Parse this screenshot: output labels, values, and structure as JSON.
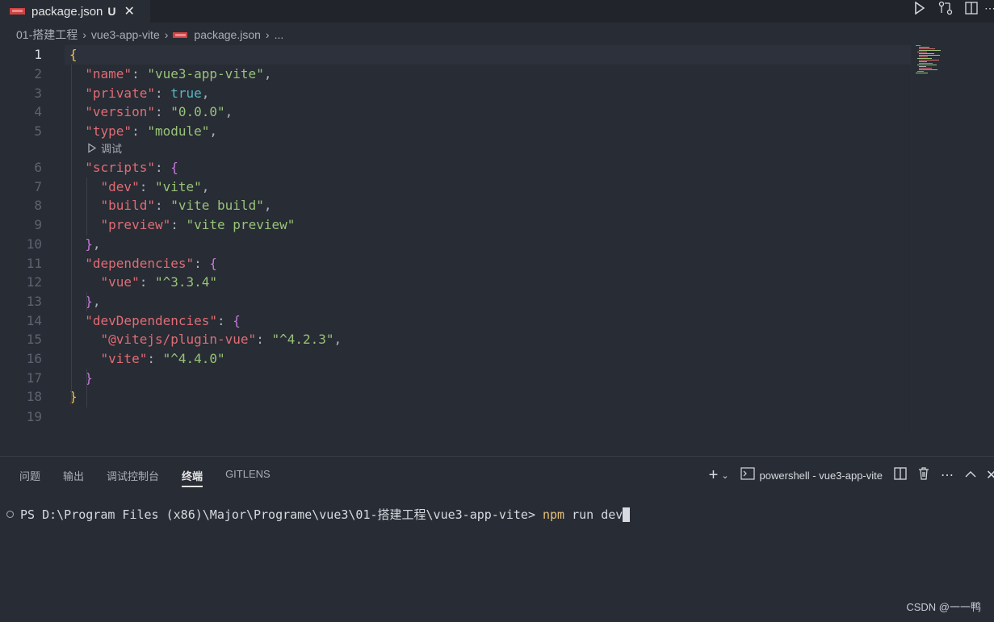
{
  "tab": {
    "label": "package.json",
    "status": "U",
    "close": "✕"
  },
  "breadcrumb": [
    "01-搭建工程",
    "vue3-app-vite",
    "package.json",
    "..."
  ],
  "editor": {
    "codelens": "调试",
    "lines": [
      {
        "n": "1",
        "t": [
          [
            "br1",
            "{"
          ]
        ]
      },
      {
        "n": "2",
        "t": [
          [
            "p",
            "  "
          ],
          [
            "k",
            "\"name\""
          ],
          [
            "p",
            ": "
          ],
          [
            "s",
            "\"vue3-app-vite\""
          ],
          [
            "p",
            ","
          ]
        ]
      },
      {
        "n": "3",
        "t": [
          [
            "p",
            "  "
          ],
          [
            "k",
            "\"private\""
          ],
          [
            "p",
            ": "
          ],
          [
            "b",
            "true"
          ],
          [
            "p",
            ","
          ]
        ]
      },
      {
        "n": "4",
        "t": [
          [
            "p",
            "  "
          ],
          [
            "k",
            "\"version\""
          ],
          [
            "p",
            ": "
          ],
          [
            "s",
            "\"0.0.0\""
          ],
          [
            "p",
            ","
          ]
        ]
      },
      {
        "n": "5",
        "t": [
          [
            "p",
            "  "
          ],
          [
            "k",
            "\"type\""
          ],
          [
            "p",
            ": "
          ],
          [
            "s",
            "\"module\""
          ],
          [
            "p",
            ","
          ]
        ]
      },
      {
        "n": "6",
        "t": [
          [
            "p",
            "  "
          ],
          [
            "k",
            "\"scripts\""
          ],
          [
            "p",
            ": "
          ],
          [
            "br2",
            "{"
          ]
        ]
      },
      {
        "n": "7",
        "t": [
          [
            "p",
            "    "
          ],
          [
            "k",
            "\"dev\""
          ],
          [
            "p",
            ": "
          ],
          [
            "s",
            "\"vite\""
          ],
          [
            "p",
            ","
          ]
        ]
      },
      {
        "n": "8",
        "t": [
          [
            "p",
            "    "
          ],
          [
            "k",
            "\"build\""
          ],
          [
            "p",
            ": "
          ],
          [
            "s",
            "\"vite build\""
          ],
          [
            "p",
            ","
          ]
        ]
      },
      {
        "n": "9",
        "t": [
          [
            "p",
            "    "
          ],
          [
            "k",
            "\"preview\""
          ],
          [
            "p",
            ": "
          ],
          [
            "s",
            "\"vite preview\""
          ]
        ]
      },
      {
        "n": "10",
        "t": [
          [
            "p",
            "  "
          ],
          [
            "br2",
            "}"
          ],
          [
            "p",
            ","
          ]
        ]
      },
      {
        "n": "11",
        "t": [
          [
            "p",
            "  "
          ],
          [
            "k",
            "\"dependencies\""
          ],
          [
            "p",
            ": "
          ],
          [
            "br2",
            "{"
          ]
        ]
      },
      {
        "n": "12",
        "t": [
          [
            "p",
            "    "
          ],
          [
            "k",
            "\"vue\""
          ],
          [
            "p",
            ": "
          ],
          [
            "s",
            "\"^3.3.4\""
          ]
        ]
      },
      {
        "n": "13",
        "t": [
          [
            "p",
            "  "
          ],
          [
            "br2",
            "}"
          ],
          [
            "p",
            ","
          ]
        ]
      },
      {
        "n": "14",
        "t": [
          [
            "p",
            "  "
          ],
          [
            "k",
            "\"devDependencies\""
          ],
          [
            "p",
            ": "
          ],
          [
            "br2",
            "{"
          ]
        ]
      },
      {
        "n": "15",
        "t": [
          [
            "p",
            "    "
          ],
          [
            "k",
            "\"@vitejs/plugin-vue\""
          ],
          [
            "p",
            ": "
          ],
          [
            "s",
            "\"^4.2.3\""
          ],
          [
            "p",
            ","
          ]
        ]
      },
      {
        "n": "16",
        "t": [
          [
            "p",
            "    "
          ],
          [
            "k",
            "\"vite\""
          ],
          [
            "p",
            ": "
          ],
          [
            "s",
            "\"^4.4.0\""
          ]
        ]
      },
      {
        "n": "17",
        "t": [
          [
            "p",
            "  "
          ],
          [
            "br2",
            "}"
          ]
        ]
      },
      {
        "n": "18",
        "t": [
          [
            "br1",
            "}"
          ]
        ]
      },
      {
        "n": "19",
        "t": []
      }
    ]
  },
  "panel": {
    "tabs": [
      "问题",
      "输出",
      "调试控制台",
      "终端",
      "GITLENS"
    ],
    "active_tab": "终端",
    "shell": "powershell - vue3-app-vite",
    "prompt": "PS D:\\Program Files (x86)\\Major\\Programe\\vue3\\01-搭建工程\\vue3-app-vite> ",
    "cmd_npm": "npm",
    "cmd_rest": " run dev"
  },
  "watermark": "CSDN @一一鸭",
  "colors": {
    "background": "#282c34",
    "keys": "#e06c75",
    "strings": "#98c379",
    "bool": "#56b6c2"
  }
}
